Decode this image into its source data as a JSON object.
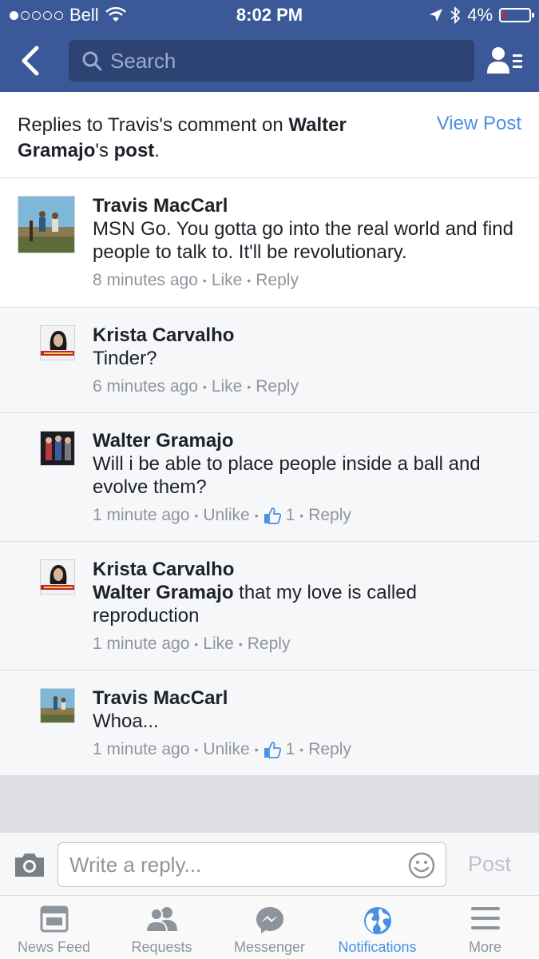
{
  "status_bar": {
    "carrier": "Bell",
    "time": "8:02 PM",
    "battery": "4%",
    "battery_level": 0.04
  },
  "header": {
    "search_placeholder": "Search"
  },
  "context": {
    "prefix": "Replies to Travis's comment on ",
    "author": "Walter Gramajo",
    "suffix_possessive": "'s ",
    "post_word": "post",
    "end": ".",
    "view_post": "View Post"
  },
  "comments": [
    {
      "name": "Travis MacCarl",
      "text": "MSN Go. You gotta go into the real world and find people to talk to. It'll be revolutionary.",
      "time": "8 minutes ago",
      "like": "Like",
      "reply": "Reply"
    },
    {
      "name": "Krista Carvalho",
      "text": "Tinder?",
      "time": "6 minutes ago",
      "like": "Like",
      "reply": "Reply"
    },
    {
      "name": "Walter Gramajo",
      "text": "Will i be able to place people inside a ball and evolve them?",
      "time": "1 minute ago",
      "like": "Unlike",
      "like_count": "1",
      "reply": "Reply"
    },
    {
      "name": "Krista Carvalho",
      "mention": "Walter Gramajo",
      "text": " that my love is called reproduction",
      "time": "1 minute ago",
      "like": "Like",
      "reply": "Reply"
    },
    {
      "name": "Travis MacCarl",
      "text": "Whoa...",
      "time": "1 minute ago",
      "like": "Unlike",
      "like_count": "1",
      "reply": "Reply"
    }
  ],
  "composer": {
    "placeholder": "Write a reply...",
    "post": "Post"
  },
  "tabs": [
    {
      "label": "News Feed",
      "icon": "news-feed-icon"
    },
    {
      "label": "Requests",
      "icon": "friend-requests-icon"
    },
    {
      "label": "Messenger",
      "icon": "messenger-icon"
    },
    {
      "label": "Notifications",
      "icon": "globe-icon",
      "active": true
    },
    {
      "label": "More",
      "icon": "menu-icon"
    }
  ],
  "colors": {
    "brand_blue": "#3b5998",
    "link_blue": "#4a90e2",
    "meta_gray": "#90949c"
  }
}
